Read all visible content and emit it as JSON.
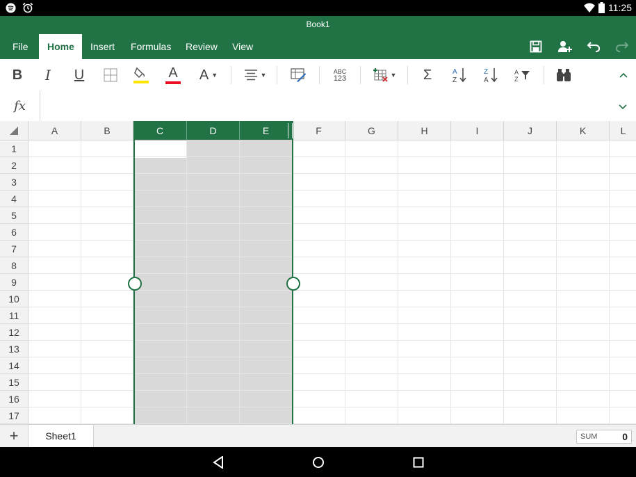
{
  "status_bar": {
    "time": "11:25"
  },
  "app": {
    "title": "Book1",
    "tabs": [
      {
        "label": "File"
      },
      {
        "label": "Home"
      },
      {
        "label": "Insert"
      },
      {
        "label": "Formulas"
      },
      {
        "label": "Review"
      },
      {
        "label": "View"
      }
    ],
    "active_tab": "Home",
    "accent_color": "#217346"
  },
  "ribbon": {
    "bold": "B",
    "italic": "I",
    "underline": "U",
    "font_color_letter": "A",
    "font_size_letter": "A",
    "spell_top": "ABC",
    "spell_bottom": "123",
    "autosum": "Σ",
    "sort_a": "A",
    "sort_z": "Z",
    "filter_az": "A Z"
  },
  "formula_bar": {
    "fx_label": "fx",
    "value": ""
  },
  "grid": {
    "columns": [
      "A",
      "B",
      "C",
      "D",
      "E",
      "F",
      "G",
      "H",
      "I",
      "J",
      "K",
      "L"
    ],
    "rows": [
      "1",
      "2",
      "3",
      "4",
      "5",
      "6",
      "7",
      "8",
      "9",
      "10",
      "11",
      "12",
      "13",
      "14",
      "15",
      "16",
      "17"
    ],
    "selected_columns": [
      "C",
      "D",
      "E"
    ],
    "active_cell": "C1"
  },
  "sheets": {
    "add_label": "+",
    "tabs": [
      "Sheet1"
    ],
    "active": "Sheet1"
  },
  "status": {
    "sum_label": "SUM",
    "sum_value": "0"
  }
}
